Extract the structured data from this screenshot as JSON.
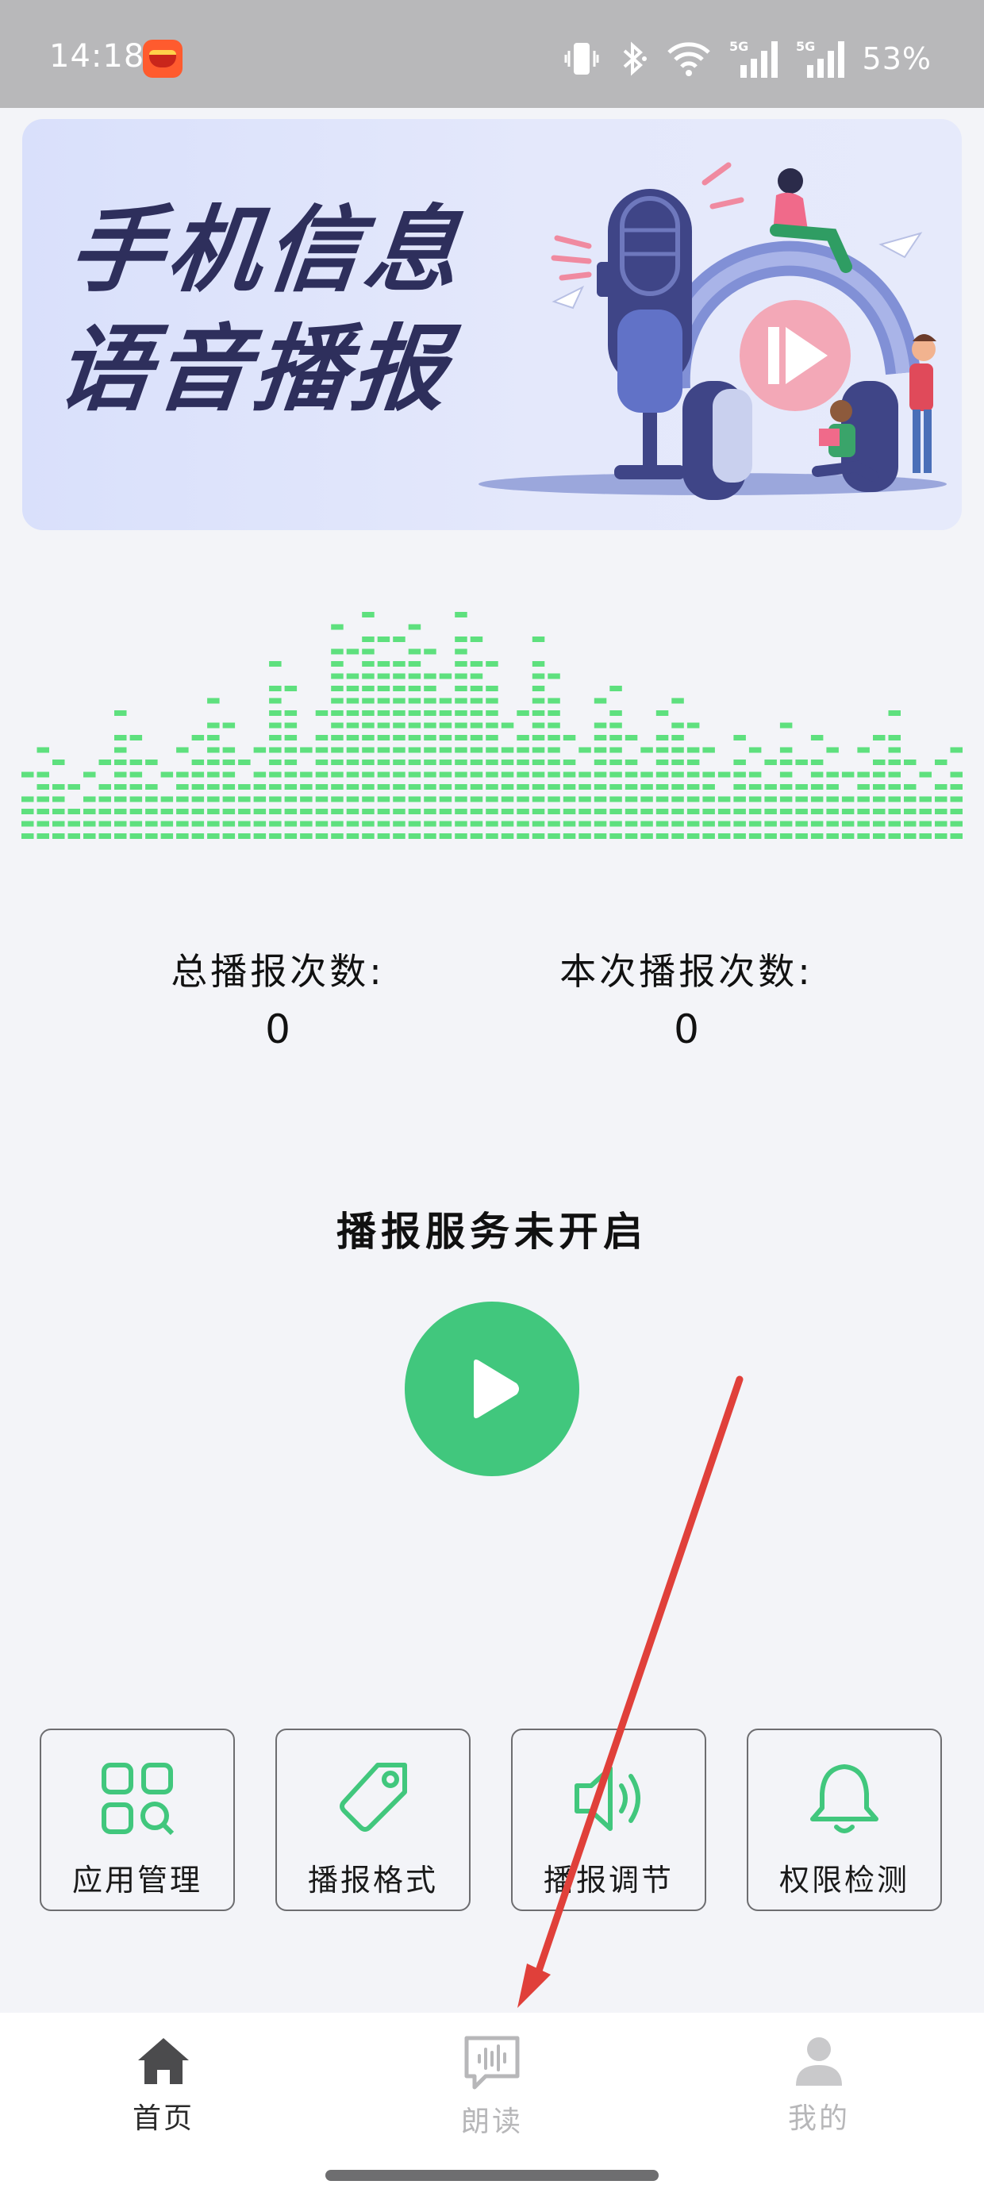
{
  "status_bar": {
    "time": "14:18",
    "battery": "53%",
    "icons": [
      "vibrate-icon",
      "bluetooth-icon",
      "wifi-icon",
      "signal-5g-icon",
      "signal-5g-icon"
    ],
    "network_label": "5G"
  },
  "banner": {
    "line1": "手机信息",
    "line2": "语音播报"
  },
  "stats": {
    "total_label": "总播报次数:",
    "total_value": "0",
    "session_label": "本次播报次数:",
    "session_value": "0"
  },
  "service": {
    "status": "播报服务未开启"
  },
  "features": [
    {
      "label": "应用管理",
      "icon": "grid-search-icon"
    },
    {
      "label": "播报格式",
      "icon": "tag-icon"
    },
    {
      "label": "播报调节",
      "icon": "speaker-icon"
    },
    {
      "label": "权限检测",
      "icon": "bell-icon"
    }
  ],
  "nav": {
    "items": [
      {
        "label": "首页",
        "icon": "home-icon",
        "active": true
      },
      {
        "label": "朗读",
        "icon": "voice-message-icon",
        "active": false
      },
      {
        "label": "我的",
        "icon": "person-icon",
        "active": false
      }
    ]
  },
  "equalizer": {
    "levels": [
      4,
      6,
      5,
      3,
      4,
      5,
      9,
      7,
      5,
      4,
      6,
      7,
      10,
      8,
      5,
      6,
      13,
      11,
      6,
      9,
      16,
      14,
      17,
      15,
      15,
      16,
      14,
      12,
      17,
      15,
      13,
      8,
      9,
      15,
      12,
      7,
      6,
      10,
      11,
      7,
      6,
      9,
      10,
      8,
      6,
      4,
      7,
      6,
      5,
      8,
      5,
      7,
      6,
      4,
      6,
      7,
      9,
      5,
      4,
      5,
      6
    ]
  },
  "colors": {
    "accent": "#41c77d",
    "equalizer": "#5ee07e",
    "status_bar": "#b8b8ba",
    "banner_text": "#2e2f5c",
    "annotation": "#e0403a"
  }
}
